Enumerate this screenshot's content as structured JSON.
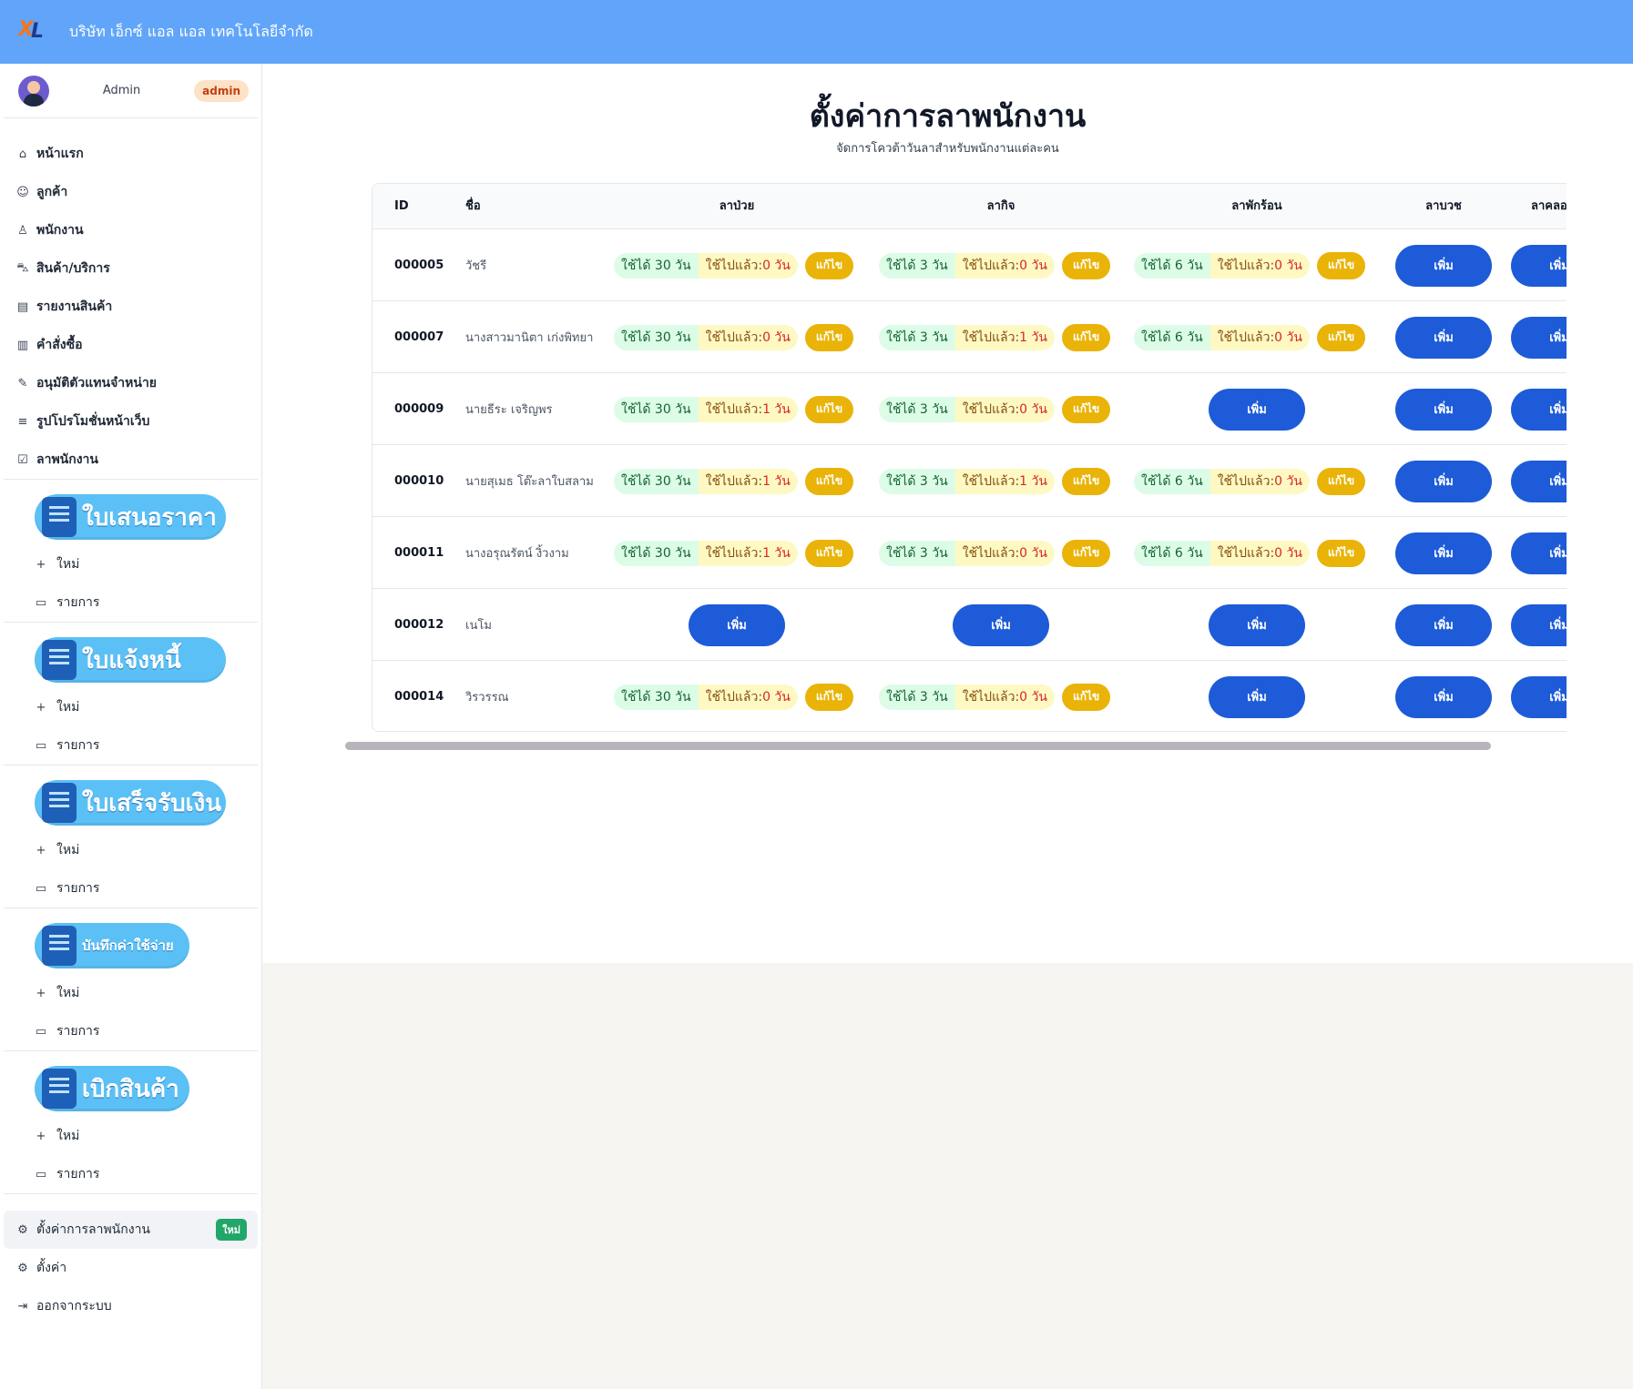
{
  "header": {
    "company": "บริษัท เอ็กซ์ แอล แอล เทคโนโลยีจำกัด",
    "logo_text": "XL"
  },
  "sidebar": {
    "user": {
      "name": "Admin",
      "role": "admin"
    },
    "nav": [
      {
        "label": "หน้าแรก",
        "icon": "home-icon"
      },
      {
        "label": "ลูกค้า",
        "icon": "users-icon"
      },
      {
        "label": "พนักงาน",
        "icon": "user-cog-icon"
      },
      {
        "label": "สินค้า/บริการ",
        "icon": "cart-icon"
      },
      {
        "label": "รายงานสินค้า",
        "icon": "report-icon"
      },
      {
        "label": "คำสั่งซื้อ",
        "icon": "order-icon"
      },
      {
        "label": "อนุมัติตัวแทนจำหน่าย",
        "icon": "approve-file-icon"
      },
      {
        "label": "รูปโปรโมชั่นหน้าเว็บ",
        "icon": "menu-lines-icon"
      },
      {
        "label": "ลาพนักงาน",
        "icon": "checkbox-icon"
      }
    ],
    "documents": [
      {
        "title": "ใบเสนอราคา",
        "new_label": "ใหม่",
        "list_label": "รายการ"
      },
      {
        "title": "ใบแจ้งหนี้",
        "new_label": "ใหม่",
        "list_label": "รายการ"
      },
      {
        "title": "ใบเสร็จรับเงิน",
        "new_label": "ใหม่",
        "list_label": "รายการ"
      },
      {
        "title": "บันทึกค่าใช้จ่าย",
        "new_label": "ใหม่",
        "list_label": "รายการ"
      },
      {
        "title": "เบิกสินค้า",
        "new_label": "ใหม่",
        "list_label": "รายการ"
      }
    ],
    "bottom": {
      "leave_settings": "ตั้งค่าการลาพนักงาน",
      "new_badge": "ใหม่",
      "settings": "ตั้งค่า",
      "logout": "ออกจากระบบ"
    }
  },
  "main": {
    "title": "ตั้งค่าการลาพนักงาน",
    "subtitle": "จัดการโควต้าวันลาสำหรับพนักงานแต่ละคน",
    "columns": [
      "ID",
      "ชื่อ",
      "ลาป่วย",
      "ลากิจ",
      "ลาพักร้อน",
      "ลาบวช",
      "ลาคลอ"
    ],
    "edit_label": "แก้ไข",
    "add_label": "เพิ่ม",
    "avail_prefix": "ใช้ได้",
    "used_prefix": "ใช้ไปแล้ว:",
    "day_unit": "วัน",
    "rows": [
      {
        "id": "000005",
        "name": "วัชรี",
        "sick": [
          "30",
          "0"
        ],
        "personal": [
          "3",
          "0"
        ],
        "vacation": [
          "6",
          "0"
        ]
      },
      {
        "id": "000007",
        "name": "นางสาวมานิตา เก่งพิทยา",
        "sick": [
          "30",
          "0"
        ],
        "personal": [
          "3",
          "1"
        ],
        "vacation": [
          "6",
          "0"
        ]
      },
      {
        "id": "000009",
        "name": "นายธีระ เจริญพร",
        "sick": [
          "30",
          "1"
        ],
        "personal": [
          "3",
          "0"
        ],
        "vacation": null
      },
      {
        "id": "000010",
        "name": "นายสุเมธ โต๊ะลาใบสลาม",
        "sick": [
          "30",
          "1"
        ],
        "personal": [
          "3",
          "1"
        ],
        "vacation": [
          "6",
          "0"
        ]
      },
      {
        "id": "000011",
        "name": "นางอรุณรัตน์ งิ้วงาม",
        "sick": [
          "30",
          "1"
        ],
        "personal": [
          "3",
          "0"
        ],
        "vacation": [
          "6",
          "0"
        ]
      },
      {
        "id": "000012",
        "name": "เนโม",
        "sick": null,
        "personal": null,
        "vacation": null
      },
      {
        "id": "000014",
        "name": "วิรวรรณ",
        "sick": [
          "30",
          "0"
        ],
        "personal": [
          "3",
          "0"
        ],
        "vacation": null
      }
    ]
  }
}
